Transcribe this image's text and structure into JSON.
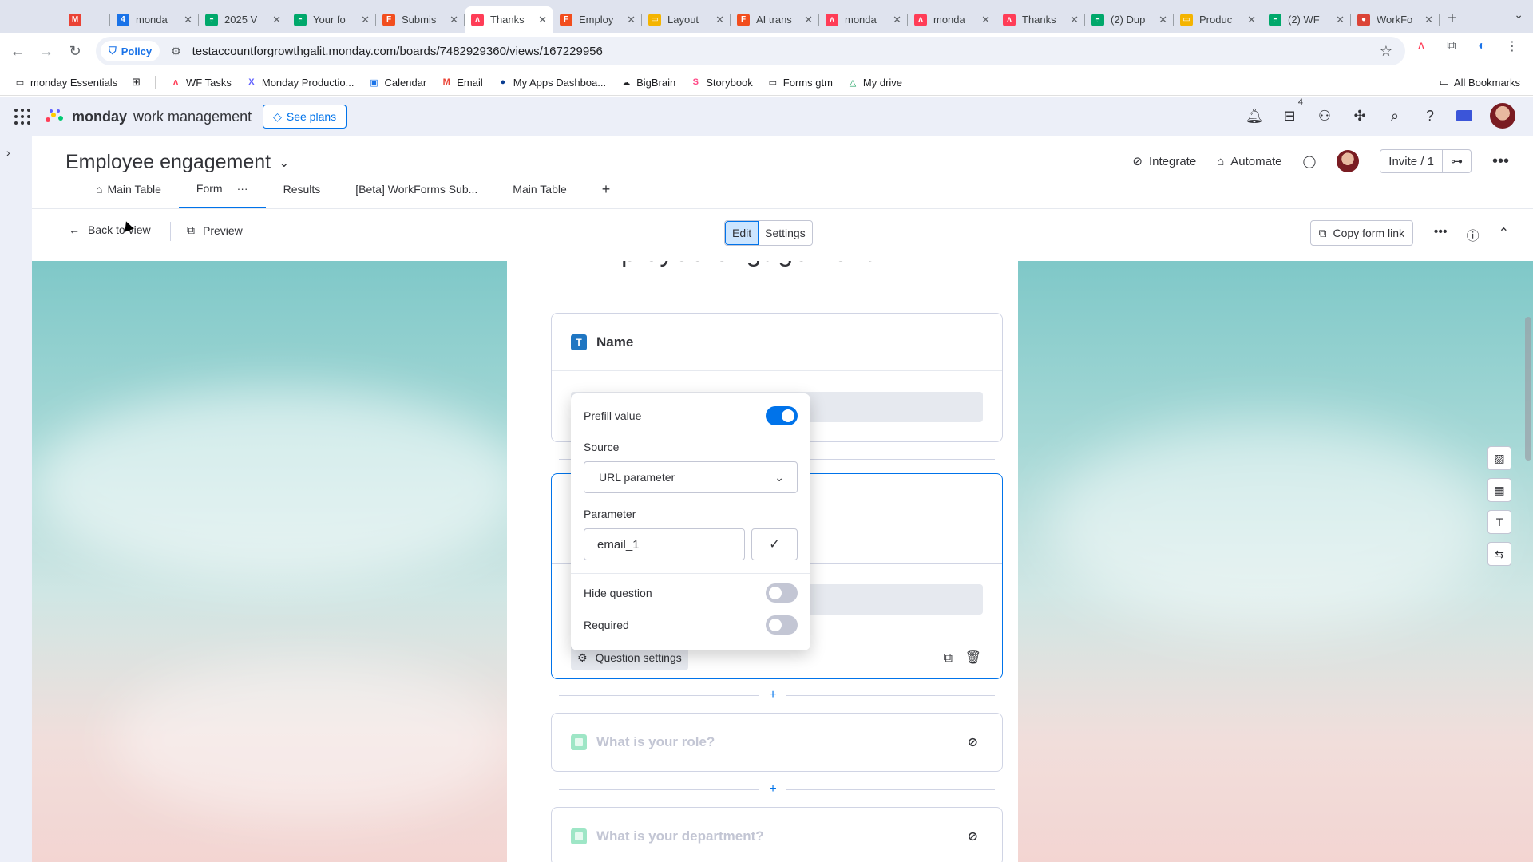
{
  "browser": {
    "tabs": [
      {
        "title": "",
        "favicon": "gmail-icon",
        "color": "#ea4335",
        "glyph": "M"
      },
      {
        "title": "monda",
        "favicon": "calendar-icon",
        "color": "#1a73e8",
        "glyph": "4"
      },
      {
        "title": "2025 V",
        "favicon": "app-icon",
        "color": "#00a86b",
        "glyph": "◓"
      },
      {
        "title": "Your fo",
        "favicon": "app-icon",
        "color": "#00a86b",
        "glyph": "◓"
      },
      {
        "title": "Submis",
        "favicon": "figma-icon",
        "color": "#f24e1e",
        "glyph": "F"
      },
      {
        "title": "Thanks",
        "favicon": "monday-icon",
        "color": "#ff3d57",
        "glyph": "ʌ",
        "active": true
      },
      {
        "title": "Employ",
        "favicon": "figma-icon",
        "color": "#f24e1e",
        "glyph": "F"
      },
      {
        "title": "Layout",
        "favicon": "slides-icon",
        "color": "#f4b400",
        "glyph": "▭"
      },
      {
        "title": "AI trans",
        "favicon": "figma-icon",
        "color": "#f24e1e",
        "glyph": "F"
      },
      {
        "title": "monda",
        "favicon": "monday-icon",
        "color": "#ff3d57",
        "glyph": "ʌ"
      },
      {
        "title": "monda",
        "favicon": "monday-icon",
        "color": "#ff3d57",
        "glyph": "ʌ"
      },
      {
        "title": "Thanks",
        "favicon": "monday-icon",
        "color": "#ff3d57",
        "glyph": "ʌ"
      },
      {
        "title": "(2) Dup",
        "favicon": "app-icon",
        "color": "#00a86b",
        "glyph": "◓"
      },
      {
        "title": "Produc",
        "favicon": "slides-icon",
        "color": "#f4b400",
        "glyph": "▭"
      },
      {
        "title": "(2) WF",
        "favicon": "app-icon",
        "color": "#00a86b",
        "glyph": "◓"
      },
      {
        "title": "WorkFo",
        "favicon": "chrome-icon",
        "color": "#db4437",
        "glyph": "●"
      }
    ],
    "close_glyph": "✕",
    "newtab_glyph": "+",
    "policy_label": "Policy",
    "url": "testaccountforgrowthgalit.monday.com/boards/7482929360/views/167229956",
    "bookmarks": [
      {
        "label": "monday Essentials",
        "icon": "folder-icon"
      },
      {
        "label": "WF Tasks",
        "icon": "monday-icon"
      },
      {
        "label": "Monday Productio...",
        "icon": "x-icon"
      },
      {
        "label": "Calendar",
        "icon": "calendar-icon"
      },
      {
        "label": "Email",
        "icon": "gmail-icon"
      },
      {
        "label": "My Apps Dashboa...",
        "icon": "circle-icon"
      },
      {
        "label": "BigBrain",
        "icon": "brain-icon"
      },
      {
        "label": "Storybook",
        "icon": "storybook-icon"
      },
      {
        "label": "Forms gtm",
        "icon": "folder-icon"
      },
      {
        "label": "My drive",
        "icon": "drive-icon"
      }
    ],
    "all_bookmarks": "All Bookmarks"
  },
  "app": {
    "brand_bold": "monday",
    "brand_rest": "work management",
    "see_plans": "See plans",
    "inbox_badge": "4",
    "accent": "#0073ea"
  },
  "board": {
    "title": "Employee engagement",
    "integrate": "Integrate",
    "automate": "Automate",
    "invite": "Invite / 1",
    "views": [
      {
        "label": "Main Table",
        "icon": "home-icon"
      },
      {
        "label": "Form",
        "active": true,
        "menu": "···"
      },
      {
        "label": "Results"
      },
      {
        "label": "[Beta] WorkForms Sub..."
      },
      {
        "label": "Main Table"
      }
    ],
    "add_view": "+"
  },
  "formbar": {
    "back": "Back to view",
    "preview": "Preview",
    "edit": "Edit",
    "settings": "Settings",
    "copy_link": "Copy form link"
  },
  "form": {
    "title_partial": "Employee engagement",
    "name_question": "Name",
    "question_settings": "Question settings",
    "role_question": "What is your role?",
    "department_question": "What is your department?",
    "add_glyph": "+"
  },
  "popover": {
    "prefill_label": "Prefill value",
    "prefill_on": true,
    "source_label": "Source",
    "source_value": "URL parameter",
    "parameter_label": "Parameter",
    "parameter_value": "email_1",
    "hide_label": "Hide question",
    "hide_on": false,
    "required_label": "Required",
    "required_on": false
  }
}
